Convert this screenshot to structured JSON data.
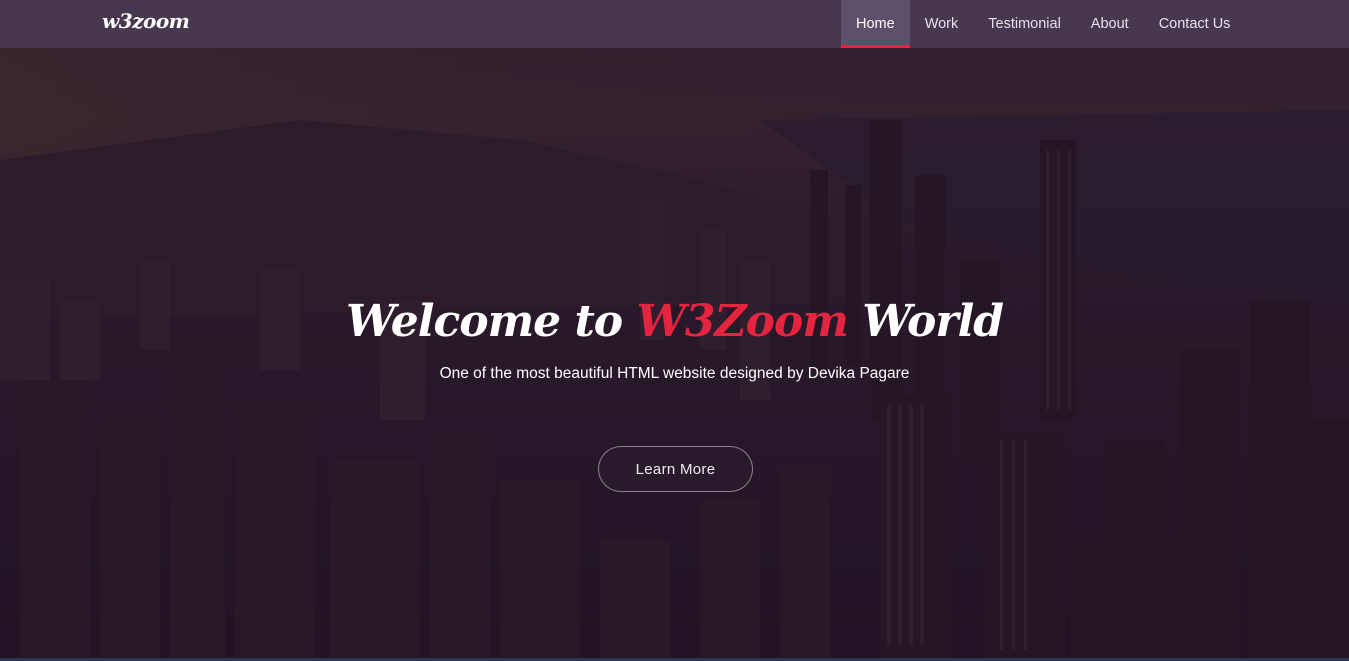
{
  "brand": {
    "logo_text": "w3zoom"
  },
  "nav": {
    "items": [
      {
        "label": "Home",
        "active": true
      },
      {
        "label": "Work",
        "active": false
      },
      {
        "label": "Testimonial",
        "active": false
      },
      {
        "label": "About",
        "active": false
      },
      {
        "label": "Contact Us",
        "active": false
      }
    ]
  },
  "hero": {
    "title_prefix": "Welcome to ",
    "title_accent": "W3Zoom",
    "title_suffix": " World",
    "subtitle": "One of the most beautiful HTML website designed by Devika Pagare",
    "cta_label": "Learn More"
  },
  "colors": {
    "navbar_bg": "#47384f",
    "nav_active_bg": "#5e4f6a",
    "accent": "#e5243f",
    "overlay": "#261428"
  }
}
